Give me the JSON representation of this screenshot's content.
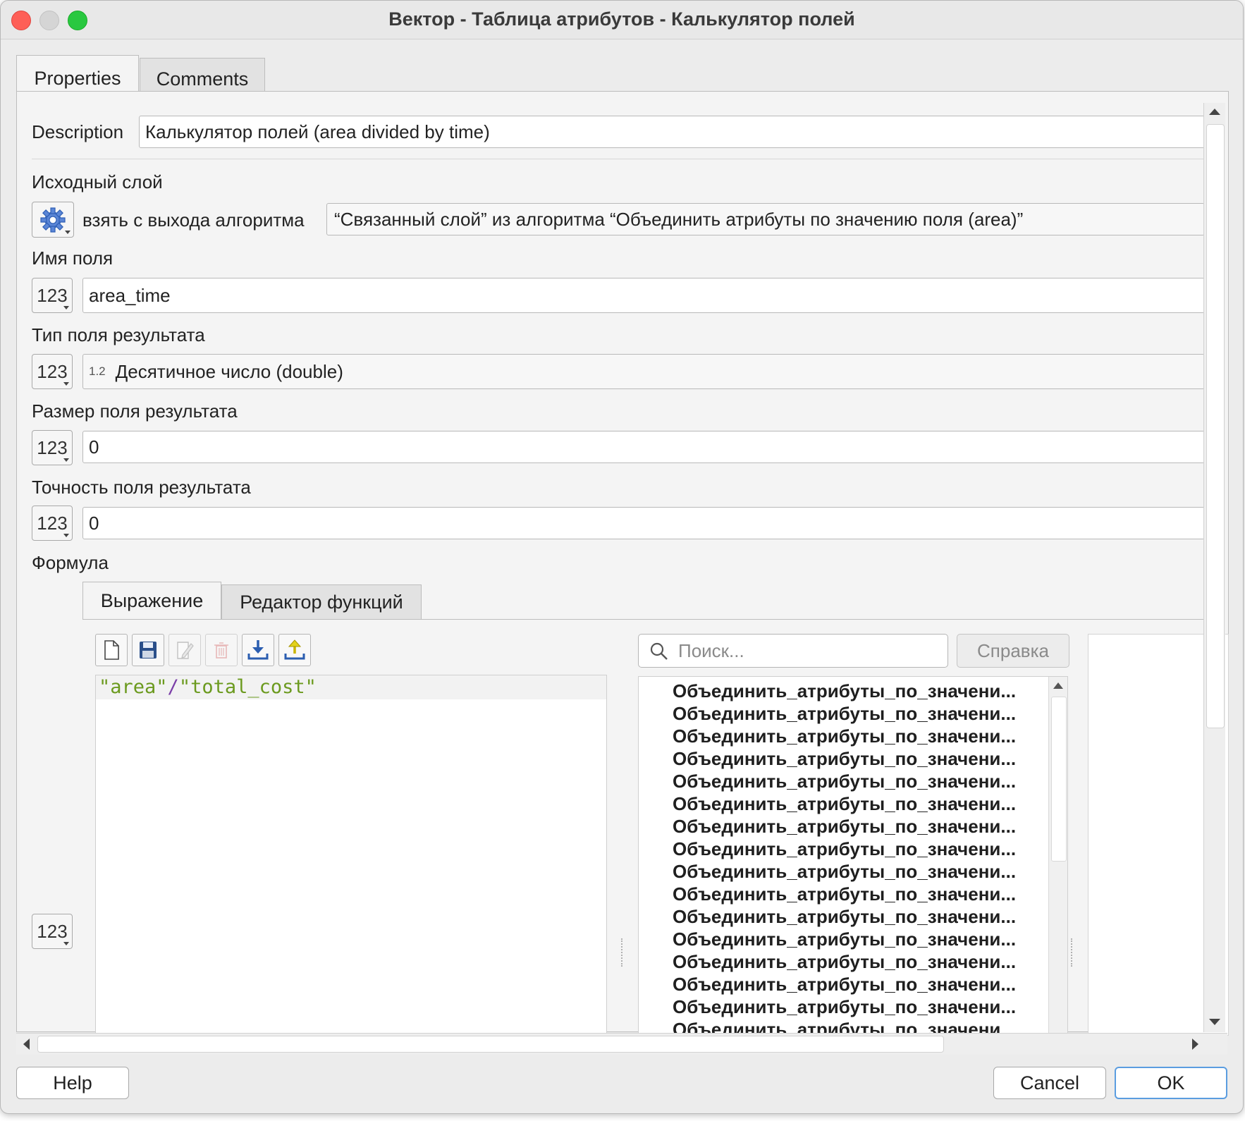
{
  "window": {
    "title": "Вектор - Таблица атрибутов - Калькулятор полей"
  },
  "tabs": [
    "Properties",
    "Comments"
  ],
  "description": {
    "label": "Description",
    "value": "Калькулятор полей (area divided by time)"
  },
  "input_layer": {
    "label": "Исходный слой",
    "source_mode": "взять с выхода алгоритма",
    "value": "“Связанный слой” из алгоритма “Объединить атрибуты по значению поля (area)”"
  },
  "field_name": {
    "label": "Имя поля",
    "value": "area_time"
  },
  "field_type": {
    "label": "Тип поля результата",
    "type_icon": "1.2",
    "value": "Десятичное число (double)"
  },
  "field_length": {
    "label": "Размер поля результата",
    "value": "0"
  },
  "field_precision": {
    "label": "Точность поля результата",
    "value": "0"
  },
  "formula": {
    "label": "Формула",
    "tabs": [
      "Выражение",
      "Редактор функций"
    ],
    "expression": {
      "left": "\"area\"",
      "op": "/",
      "right": "\"total_cost\""
    },
    "search_placeholder": "Поиск...",
    "help_button": "Справка",
    "tree_items": [
      "Объединить_атрибуты_по_значени...",
      "Объединить_атрибуты_по_значени...",
      "Объединить_атрибуты_по_значени...",
      "Объединить_атрибуты_по_значени...",
      "Объединить_атрибуты_по_значени...",
      "Объединить_атрибуты_по_значени...",
      "Объединить_атрибуты_по_значени...",
      "Объединить_атрибуты_по_значени...",
      "Объединить_атрибуты_по_значени...",
      "Объединить_атрибуты_по_значени...",
      "Объединить_атрибуты_по_значени...",
      "Объединить_атрибуты_по_значени...",
      "Объединить_атрибуты_по_значени...",
      "Объединить_атрибуты_по_значени...",
      "Объединить_атрибуты_по_значени...",
      "Объединить_атрибуты_по_значени..."
    ]
  },
  "param_button_text": "123",
  "footer": {
    "help": "Help",
    "cancel": "Cancel",
    "ok": "OK"
  },
  "icons": [
    "gear-icon",
    "new-file-icon",
    "save-icon",
    "edit-icon",
    "delete-icon",
    "import-icon",
    "export-icon",
    "search-icon",
    "scroll-up-icon",
    "scroll-down-icon",
    "scroll-left-icon",
    "scroll-right-icon"
  ]
}
